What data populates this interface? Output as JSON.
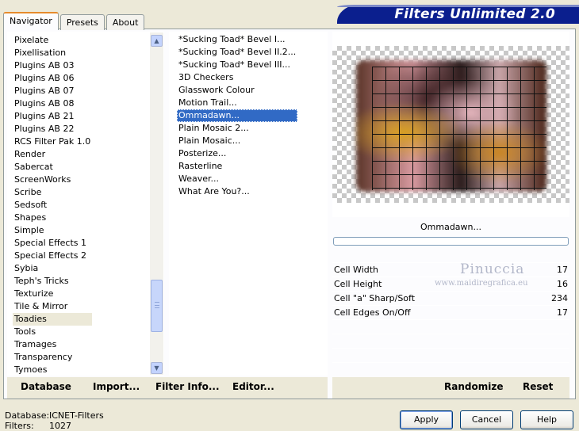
{
  "window": {
    "title": "Filters Unlimited 2.0"
  },
  "tabs": [
    {
      "label": "Navigator",
      "active": true
    },
    {
      "label": "Presets",
      "active": false
    },
    {
      "label": "About",
      "active": false
    }
  ],
  "categories": {
    "items": [
      "Pixelate",
      "Pixellisation",
      "Plugins AB 03",
      "Plugins AB 06",
      "Plugins AB 07",
      "Plugins AB 08",
      "Plugins AB 21",
      "Plugins AB 22",
      "RCS Filter Pak 1.0",
      "Render",
      "Sabercat",
      "ScreenWorks",
      "Scribe",
      "Sedsoft",
      "Shapes",
      "Simple",
      "Special Effects 1",
      "Special Effects 2",
      "Sybia",
      "Teph's Tricks",
      "Texturize",
      "Tile & Mirror",
      "Toadies",
      "Tools",
      "Tramages",
      "Transparency",
      "Tymoes"
    ],
    "selected": "Toadies"
  },
  "filters": {
    "items": [
      "*Sucking Toad*  Bevel I...",
      "*Sucking Toad*  Bevel II.2...",
      "*Sucking Toad*  Bevel III...",
      "3D Checkers",
      "Glasswork Colour",
      "Motion Trail...",
      "Ommadawn...",
      "Plain Mosaic 2...",
      "Plain Mosaic...",
      "Posterize...",
      "Rasterline",
      "Weaver...",
      "What Are You?..."
    ],
    "selected": "Ommadawn..."
  },
  "preview": {
    "filter_name": "Ommadawn..."
  },
  "watermark": {
    "line1": "Pinuccia",
    "line2": "www.maidiregrafica.eu"
  },
  "params": [
    {
      "label": "Cell Width",
      "value": "17"
    },
    {
      "label": "Cell Height",
      "value": "16"
    },
    {
      "label": "Cell \"a\" Sharp/Soft",
      "value": "234"
    },
    {
      "label": "Cell Edges On/Off",
      "value": "17"
    }
  ],
  "left_buttons": {
    "database": "Database",
    "import": "Import...",
    "filter_info": "Filter Info...",
    "editor": "Editor..."
  },
  "right_buttons": {
    "randomize": "Randomize",
    "reset": "Reset"
  },
  "status": {
    "database_label": "Database:",
    "database_value": "ICNET-Filters",
    "filters_label": "Filters:",
    "filters_value": "1027"
  },
  "dialog_buttons": {
    "apply": "Apply",
    "cancel": "Cancel",
    "help": "Help"
  },
  "colors": {
    "title_bar": "#0b1f8e",
    "selection": "#316ac5",
    "face": "#ece9d8"
  }
}
